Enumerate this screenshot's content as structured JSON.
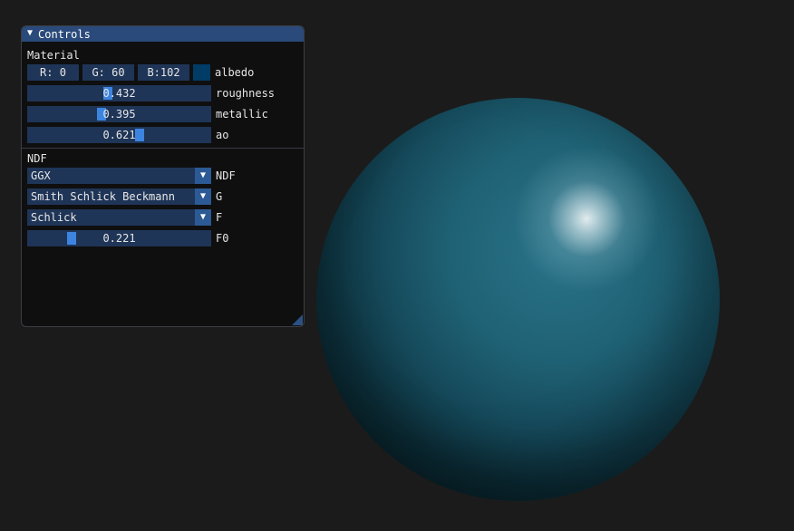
{
  "window": {
    "title": "Controls",
    "collapse_icon": "▼"
  },
  "material": {
    "section_label": "Material",
    "albedo": {
      "r": "R:  0",
      "g": "G: 60",
      "b": "B:102",
      "label": "albedo",
      "swatch_color": "#003c66"
    },
    "roughness": {
      "value_text": "0.432",
      "value": 0.432,
      "label": "roughness"
    },
    "metallic": {
      "value_text": "0.395",
      "value": 0.395,
      "label": "metallic"
    },
    "ao": {
      "value_text": "0.621",
      "value": 0.621,
      "label": "ao"
    }
  },
  "ndf_section": {
    "section_label": "NDF",
    "ndf": {
      "selected": "GGX",
      "label": "NDF"
    },
    "g": {
      "selected": "Smith Schlick Beckmann",
      "label": "G"
    },
    "f": {
      "selected": "Schlick",
      "label": "F"
    },
    "f0": {
      "value_text": "0.221",
      "value": 0.221,
      "label": "F0"
    }
  },
  "combo_arrow_icon": "▼",
  "colors": {
    "background": "#1b1b1b",
    "titlebar": "#294a7a",
    "frame": "#1f3557",
    "slider_grab": "#3d84e0",
    "sphere": "#1f6174"
  }
}
